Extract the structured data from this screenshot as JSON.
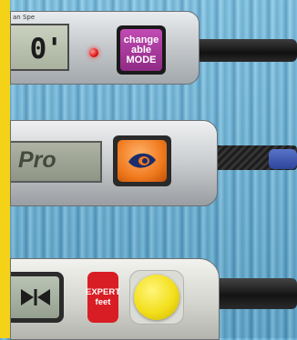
{
  "devices": [
    {
      "name": "gauge-mode",
      "brand_text": "an Spe",
      "lcd_value": "0'",
      "mode_button": {
        "line1": "change",
        "line2": "able",
        "line3": "MODE"
      },
      "colors": {
        "button": "#a03c98",
        "led": "#e01515"
      }
    },
    {
      "name": "gauge-pro",
      "lcd_value": "Pro",
      "button_icon": "eye-icon",
      "colors": {
        "button": "#f07a1e"
      }
    },
    {
      "name": "gauge-expert",
      "lcd_icon": "bowtie-arrows-icon",
      "expert_button": {
        "line1": "EXPERT",
        "line2": "feet"
      },
      "colors": {
        "expert": "#d81e24",
        "yellow_button": "#f3df1c"
      }
    }
  ],
  "colors": {
    "left_strip": "#f3d217",
    "background": "#6fb6da",
    "cable_blue": "#3a58a8"
  }
}
